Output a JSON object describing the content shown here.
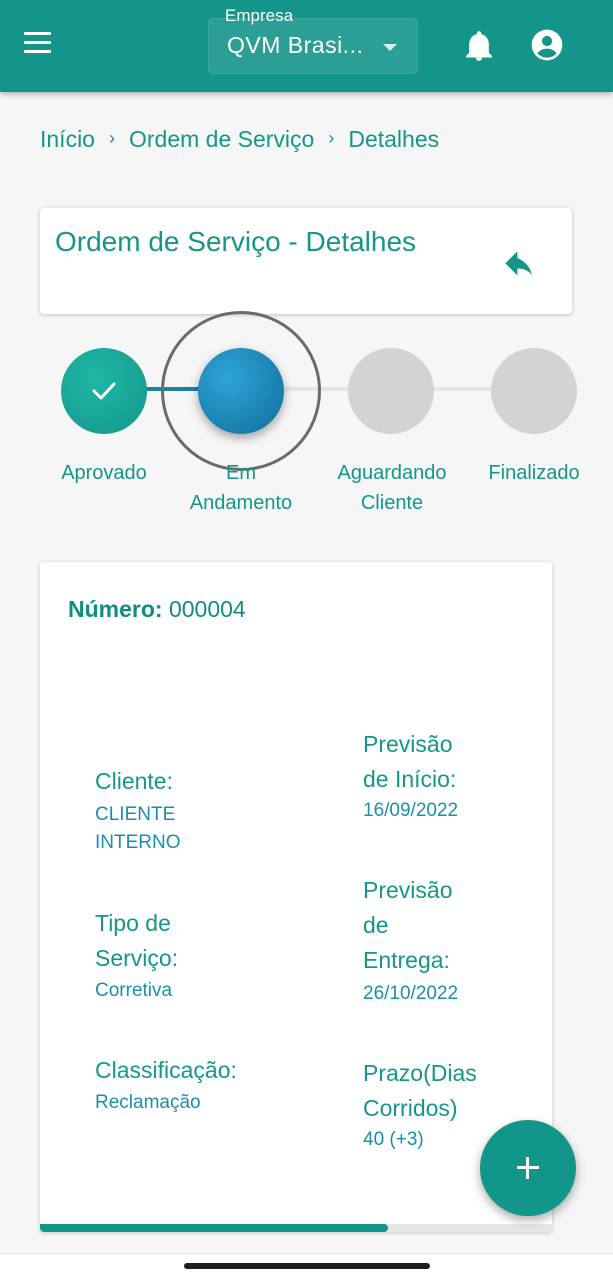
{
  "appbar": {
    "company_label": "Empresa",
    "company_value": "QVM Brasi...",
    "colors": {
      "primary": "#14958a",
      "icon": "#ffffff"
    }
  },
  "breadcrumb": {
    "items": [
      "Início",
      "Ordem de Serviço",
      "Detalhes"
    ],
    "separator": "›"
  },
  "title_card": {
    "title": "Ordem de Serviço - Detalhes",
    "back_icon": "reply-arrow-icon"
  },
  "stepper": {
    "steps": [
      {
        "label_line1": "Aprovado",
        "label_line2": "",
        "state": "done"
      },
      {
        "label_line1": "Em",
        "label_line2": "Andamento",
        "state": "active"
      },
      {
        "label_line1": "Aguardando",
        "label_line2": "Cliente",
        "state": "pending"
      },
      {
        "label_line1": "Finalizado",
        "label_line2": "",
        "state": "pending"
      }
    ],
    "colors": {
      "done": "#13968a",
      "active": "#1a87bd",
      "pending": "#d3d3d3"
    }
  },
  "details": {
    "numero_label": "Número:",
    "numero_value": "000004",
    "cliente_label": "Cliente:",
    "cliente_value_l1": "CLIENTE",
    "cliente_value_l2": "INTERNO",
    "tipo_label_l1": "Tipo de",
    "tipo_label_l2": "Serviço:",
    "tipo_value": "Corretiva",
    "classificacao_label": "Classificação:",
    "classificacao_value": "Reclamação",
    "prev_inicio_label_l1": "Previsão",
    "prev_inicio_label_l2": "de Início:",
    "prev_inicio_value": "16/09/2022",
    "prev_entrega_label_l1": "Previsão",
    "prev_entrega_label_l2": "de",
    "prev_entrega_label_l3": "Entrega:",
    "prev_entrega_value": "26/10/2022",
    "prazo_label_l1": "Prazo(Dias",
    "prazo_label_l2": "Corridos)",
    "prazo_value": "40 (+3)",
    "scroll_progress": 0.68
  },
  "fab": {
    "icon": "plus-icon"
  }
}
